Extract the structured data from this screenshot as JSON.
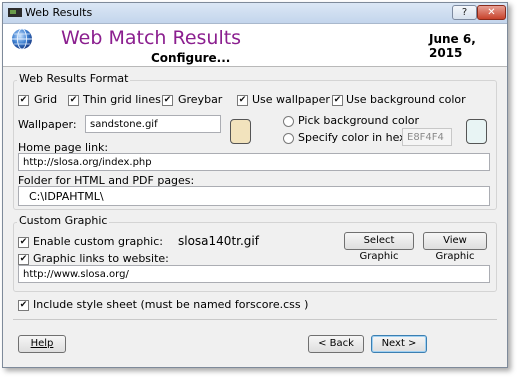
{
  "window": {
    "title": "Web Results",
    "help_btn": "?",
    "close_btn": "✕"
  },
  "header": {
    "title": "Web Match Results",
    "subtitle": "Configure...",
    "date": "June  6, 2015"
  },
  "format": {
    "group_label": "Web Results Format",
    "options": {
      "grid": {
        "label": "Grid",
        "checked": true
      },
      "thin_grid": {
        "label": "Thin grid lines",
        "checked": true
      },
      "greybar": {
        "label": "Greybar",
        "checked": true
      },
      "use_wallpaper": {
        "label": "Use wallpaper",
        "checked": true
      },
      "use_bg_color": {
        "label": "Use background color",
        "checked": true
      }
    },
    "wallpaper_label": "Wallpaper:",
    "wallpaper_value": "sandstone.gif",
    "wallpaper_swatch_color": "#f2e3bd",
    "pick_bg_label": "Pick background color",
    "specify_hex_label": "Specify color in hex:",
    "hex_value": "E8F4F4",
    "hex_swatch_color": "#e8f4f4",
    "home_label": "Home page link:",
    "home_value": "http://slosa.org/index.php",
    "folder_label": "Folder for HTML and PDF pages:",
    "folder_value": "C:\\IDPAHTML\\"
  },
  "graphic": {
    "group_label": "Custom Graphic",
    "enable_label": "Enable custom graphic:",
    "enable_checked": true,
    "file_name": "slosa140tr.gif",
    "select_btn": "Select Graphic",
    "view_btn": "View Graphic",
    "links_label": "Graphic links to website:",
    "links_checked": true,
    "url_value": "http://www.slosa.org/"
  },
  "stylesheet": {
    "label": "Include style sheet (must be named  forscore.css  )",
    "checked": true
  },
  "footer": {
    "help": "Help",
    "back": "< Back",
    "next": "Next >"
  },
  "colors": {
    "title_accent": "#8b1f8f"
  }
}
